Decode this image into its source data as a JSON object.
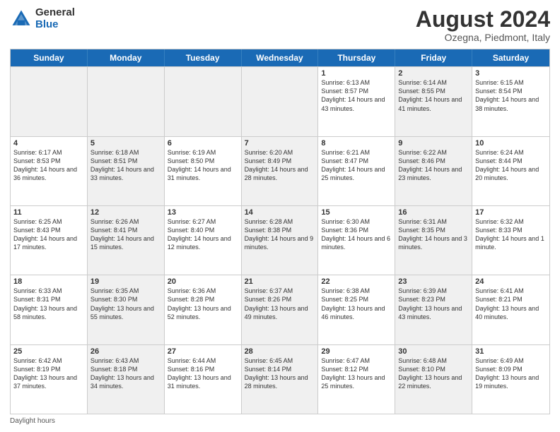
{
  "header": {
    "logo_general": "General",
    "logo_blue": "Blue",
    "month_year": "August 2024",
    "location": "Ozegna, Piedmont, Italy"
  },
  "weekdays": [
    "Sunday",
    "Monday",
    "Tuesday",
    "Wednesday",
    "Thursday",
    "Friday",
    "Saturday"
  ],
  "rows": [
    [
      {
        "day": "",
        "text": "",
        "shaded": true
      },
      {
        "day": "",
        "text": "",
        "shaded": true
      },
      {
        "day": "",
        "text": "",
        "shaded": true
      },
      {
        "day": "",
        "text": "",
        "shaded": true
      },
      {
        "day": "1",
        "text": "Sunrise: 6:13 AM\nSunset: 8:57 PM\nDaylight: 14 hours and 43 minutes.",
        "shaded": false
      },
      {
        "day": "2",
        "text": "Sunrise: 6:14 AM\nSunset: 8:55 PM\nDaylight: 14 hours and 41 minutes.",
        "shaded": true
      },
      {
        "day": "3",
        "text": "Sunrise: 6:15 AM\nSunset: 8:54 PM\nDaylight: 14 hours and 38 minutes.",
        "shaded": false
      }
    ],
    [
      {
        "day": "4",
        "text": "Sunrise: 6:17 AM\nSunset: 8:53 PM\nDaylight: 14 hours and 36 minutes.",
        "shaded": false
      },
      {
        "day": "5",
        "text": "Sunrise: 6:18 AM\nSunset: 8:51 PM\nDaylight: 14 hours and 33 minutes.",
        "shaded": true
      },
      {
        "day": "6",
        "text": "Sunrise: 6:19 AM\nSunset: 8:50 PM\nDaylight: 14 hours and 31 minutes.",
        "shaded": false
      },
      {
        "day": "7",
        "text": "Sunrise: 6:20 AM\nSunset: 8:49 PM\nDaylight: 14 hours and 28 minutes.",
        "shaded": true
      },
      {
        "day": "8",
        "text": "Sunrise: 6:21 AM\nSunset: 8:47 PM\nDaylight: 14 hours and 25 minutes.",
        "shaded": false
      },
      {
        "day": "9",
        "text": "Sunrise: 6:22 AM\nSunset: 8:46 PM\nDaylight: 14 hours and 23 minutes.",
        "shaded": true
      },
      {
        "day": "10",
        "text": "Sunrise: 6:24 AM\nSunset: 8:44 PM\nDaylight: 14 hours and 20 minutes.",
        "shaded": false
      }
    ],
    [
      {
        "day": "11",
        "text": "Sunrise: 6:25 AM\nSunset: 8:43 PM\nDaylight: 14 hours and 17 minutes.",
        "shaded": false
      },
      {
        "day": "12",
        "text": "Sunrise: 6:26 AM\nSunset: 8:41 PM\nDaylight: 14 hours and 15 minutes.",
        "shaded": true
      },
      {
        "day": "13",
        "text": "Sunrise: 6:27 AM\nSunset: 8:40 PM\nDaylight: 14 hours and 12 minutes.",
        "shaded": false
      },
      {
        "day": "14",
        "text": "Sunrise: 6:28 AM\nSunset: 8:38 PM\nDaylight: 14 hours and 9 minutes.",
        "shaded": true
      },
      {
        "day": "15",
        "text": "Sunrise: 6:30 AM\nSunset: 8:36 PM\nDaylight: 14 hours and 6 minutes.",
        "shaded": false
      },
      {
        "day": "16",
        "text": "Sunrise: 6:31 AM\nSunset: 8:35 PM\nDaylight: 14 hours and 3 minutes.",
        "shaded": true
      },
      {
        "day": "17",
        "text": "Sunrise: 6:32 AM\nSunset: 8:33 PM\nDaylight: 14 hours and 1 minute.",
        "shaded": false
      }
    ],
    [
      {
        "day": "18",
        "text": "Sunrise: 6:33 AM\nSunset: 8:31 PM\nDaylight: 13 hours and 58 minutes.",
        "shaded": false
      },
      {
        "day": "19",
        "text": "Sunrise: 6:35 AM\nSunset: 8:30 PM\nDaylight: 13 hours and 55 minutes.",
        "shaded": true
      },
      {
        "day": "20",
        "text": "Sunrise: 6:36 AM\nSunset: 8:28 PM\nDaylight: 13 hours and 52 minutes.",
        "shaded": false
      },
      {
        "day": "21",
        "text": "Sunrise: 6:37 AM\nSunset: 8:26 PM\nDaylight: 13 hours and 49 minutes.",
        "shaded": true
      },
      {
        "day": "22",
        "text": "Sunrise: 6:38 AM\nSunset: 8:25 PM\nDaylight: 13 hours and 46 minutes.",
        "shaded": false
      },
      {
        "day": "23",
        "text": "Sunrise: 6:39 AM\nSunset: 8:23 PM\nDaylight: 13 hours and 43 minutes.",
        "shaded": true
      },
      {
        "day": "24",
        "text": "Sunrise: 6:41 AM\nSunset: 8:21 PM\nDaylight: 13 hours and 40 minutes.",
        "shaded": false
      }
    ],
    [
      {
        "day": "25",
        "text": "Sunrise: 6:42 AM\nSunset: 8:19 PM\nDaylight: 13 hours and 37 minutes.",
        "shaded": false
      },
      {
        "day": "26",
        "text": "Sunrise: 6:43 AM\nSunset: 8:18 PM\nDaylight: 13 hours and 34 minutes.",
        "shaded": true
      },
      {
        "day": "27",
        "text": "Sunrise: 6:44 AM\nSunset: 8:16 PM\nDaylight: 13 hours and 31 minutes.",
        "shaded": false
      },
      {
        "day": "28",
        "text": "Sunrise: 6:45 AM\nSunset: 8:14 PM\nDaylight: 13 hours and 28 minutes.",
        "shaded": true
      },
      {
        "day": "29",
        "text": "Sunrise: 6:47 AM\nSunset: 8:12 PM\nDaylight: 13 hours and 25 minutes.",
        "shaded": false
      },
      {
        "day": "30",
        "text": "Sunrise: 6:48 AM\nSunset: 8:10 PM\nDaylight: 13 hours and 22 minutes.",
        "shaded": true
      },
      {
        "day": "31",
        "text": "Sunrise: 6:49 AM\nSunset: 8:09 PM\nDaylight: 13 hours and 19 minutes.",
        "shaded": false
      }
    ]
  ],
  "footer": "Daylight hours"
}
